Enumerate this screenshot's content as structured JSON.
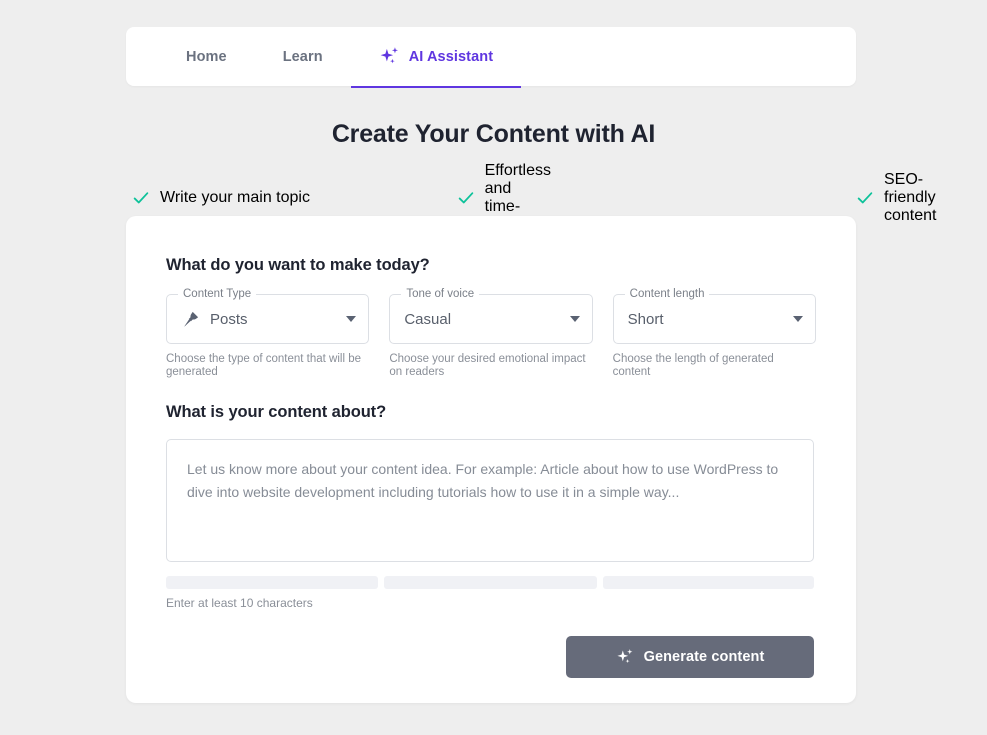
{
  "colors": {
    "page_background": "#eeeeee",
    "accent_purple": "#5f36e0",
    "check_green": "#0ec29a",
    "button_gray": "#666b7a",
    "title_dark": "#1f2330",
    "muted_text": "#8a8f98",
    "border": "#dcdfe4",
    "skeleton": "#f0f1f5"
  },
  "navbar": {
    "tabs": [
      {
        "label": "Home",
        "icon": null,
        "active": false
      },
      {
        "label": "Learn",
        "icon": null,
        "active": false
      },
      {
        "label": "AI Assistant",
        "icon": "sparkle-icon",
        "active": true
      }
    ]
  },
  "header": {
    "title": "Create Your Content with AI"
  },
  "features": [
    {
      "icon": "check-icon",
      "label": "Write your main topic"
    },
    {
      "icon": "check-icon",
      "label": "Effortless and time-saving"
    },
    {
      "icon": "check-icon",
      "label": "SEO-friendly content"
    }
  ],
  "form": {
    "make_today_title": "What do you want to make today?",
    "selects": [
      {
        "legend": "Content Type",
        "value": "Posts",
        "icon": "pushpin-icon",
        "helper": "Choose the type of content that will be generated"
      },
      {
        "legend": "Tone of voice",
        "value": "Casual",
        "icon": null,
        "helper": "Choose your desired emotional impact on readers"
      },
      {
        "legend": "Content length",
        "value": "Short",
        "icon": null,
        "helper": "Choose the length of generated content"
      }
    ],
    "about_title": "What is your content about?",
    "textarea": {
      "value": "",
      "placeholder": "Let us know more about your content idea. For example: Article about how to use WordPress to dive into website development including tutorials how to use it in a simple way..."
    },
    "min_chars_note": "Enter at least 10 characters",
    "generate_button": {
      "label": "Generate content",
      "icon": "sparkle-icon"
    }
  }
}
